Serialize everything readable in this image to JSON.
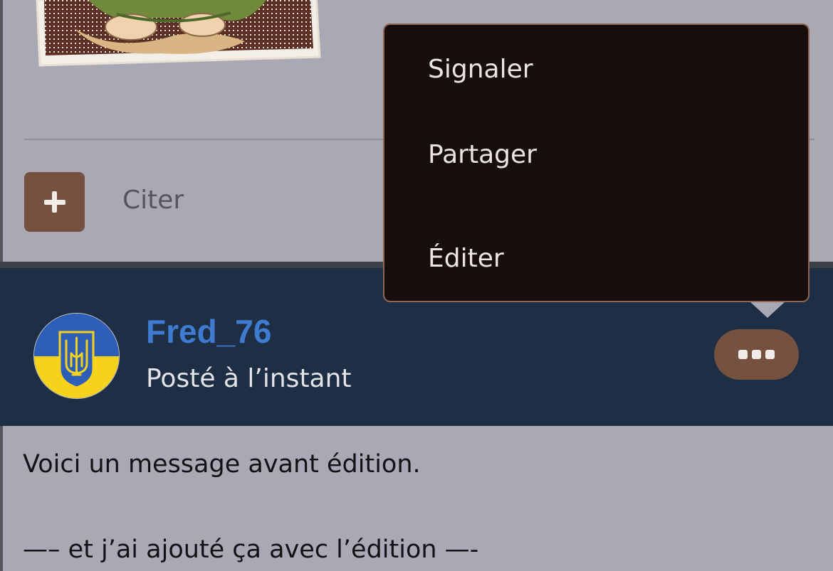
{
  "previous_post": {
    "quote_label": "Citer",
    "add_button_symbol": "+",
    "image_icon": "animated-character-image"
  },
  "post": {
    "username": "Fred_76",
    "time": "Posté à l’instant",
    "avatar": "ukraine-flag-trident-avatar",
    "more_button_icon": "more-options-icon",
    "body": {
      "line1": "Voici un message avant édition.",
      "line2": "—– et j’ai ajouté ça avec l’édition —-"
    }
  },
  "menu": {
    "items": [
      {
        "label": "Signaler"
      },
      {
        "label": "Partager"
      },
      {
        "label": "Éditer"
      }
    ]
  },
  "colors": {
    "accent_brown": "#75513f",
    "header_navy": "#1e2e45",
    "username_blue": "#3f7bd0",
    "menu_bg": "#170e0b",
    "page_bg": "#a9a9b5"
  }
}
